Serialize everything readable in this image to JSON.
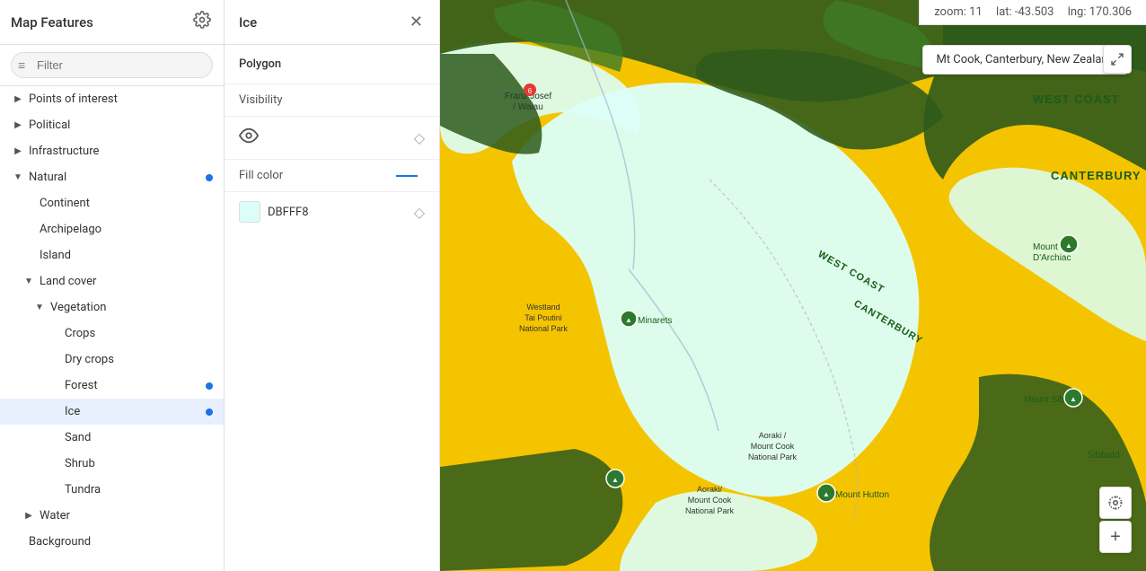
{
  "sidebar": {
    "title": "Map Features",
    "filter_placeholder": "Filter",
    "items": [
      {
        "id": "points-of-interest",
        "label": "Points of interest",
        "indent": 0,
        "chevron": "▶",
        "dot": false,
        "selected": false
      },
      {
        "id": "political",
        "label": "Political",
        "indent": 0,
        "chevron": "▶",
        "dot": false,
        "selected": false
      },
      {
        "id": "infrastructure",
        "label": "Infrastructure",
        "indent": 0,
        "chevron": "▶",
        "dot": false,
        "selected": false
      },
      {
        "id": "natural",
        "label": "Natural",
        "indent": 0,
        "chevron": "▼",
        "dot": true,
        "selected": false
      },
      {
        "id": "continent",
        "label": "Continent",
        "indent": 1,
        "chevron": "",
        "dot": false,
        "selected": false
      },
      {
        "id": "archipelago",
        "label": "Archipelago",
        "indent": 1,
        "chevron": "",
        "dot": false,
        "selected": false
      },
      {
        "id": "island",
        "label": "Island",
        "indent": 1,
        "chevron": "",
        "dot": false,
        "selected": false
      },
      {
        "id": "land-cover",
        "label": "Land cover",
        "indent": 1,
        "chevron": "▼",
        "dot": false,
        "selected": false
      },
      {
        "id": "vegetation",
        "label": "Vegetation",
        "indent": 2,
        "chevron": "▼",
        "dot": false,
        "selected": false
      },
      {
        "id": "crops",
        "label": "Crops",
        "indent": 3,
        "chevron": "",
        "dot": false,
        "selected": false
      },
      {
        "id": "dry-crops",
        "label": "Dry crops",
        "indent": 3,
        "chevron": "",
        "dot": false,
        "selected": false
      },
      {
        "id": "forest",
        "label": "Forest",
        "indent": 3,
        "chevron": "",
        "dot": true,
        "selected": false
      },
      {
        "id": "ice",
        "label": "Ice",
        "indent": 3,
        "chevron": "",
        "dot": true,
        "selected": true
      },
      {
        "id": "sand",
        "label": "Sand",
        "indent": 3,
        "chevron": "",
        "dot": false,
        "selected": false
      },
      {
        "id": "shrub",
        "label": "Shrub",
        "indent": 3,
        "chevron": "",
        "dot": false,
        "selected": false
      },
      {
        "id": "tundra",
        "label": "Tundra",
        "indent": 3,
        "chevron": "",
        "dot": false,
        "selected": false
      },
      {
        "id": "water",
        "label": "Water",
        "indent": 1,
        "chevron": "▶",
        "dot": false,
        "selected": false
      },
      {
        "id": "background",
        "label": "Background",
        "indent": 0,
        "chevron": "",
        "dot": false,
        "selected": false
      }
    ]
  },
  "detail": {
    "title": "Ice",
    "type_label": "Polygon",
    "visibility_label": "Visibility",
    "fill_color_label": "Fill color",
    "color_hex": "DBFFF8",
    "color_value": "#DBFFF8"
  },
  "map": {
    "zoom_label": "zoom:",
    "zoom_value": "11",
    "lat_label": "lat:",
    "lat_value": "-43.503",
    "lng_label": "lng:",
    "lng_value": "170.306",
    "location_tooltip": "Mt Cook, Canterbury, New Zealand",
    "fullscreen_icon": "⤢",
    "location_icon": "◎",
    "plus_icon": "+"
  },
  "colors": {
    "ice": "#DBFFF8",
    "forest": "#2d6a2d",
    "grassland": "#c8b400",
    "accent": "#1a73e8"
  }
}
